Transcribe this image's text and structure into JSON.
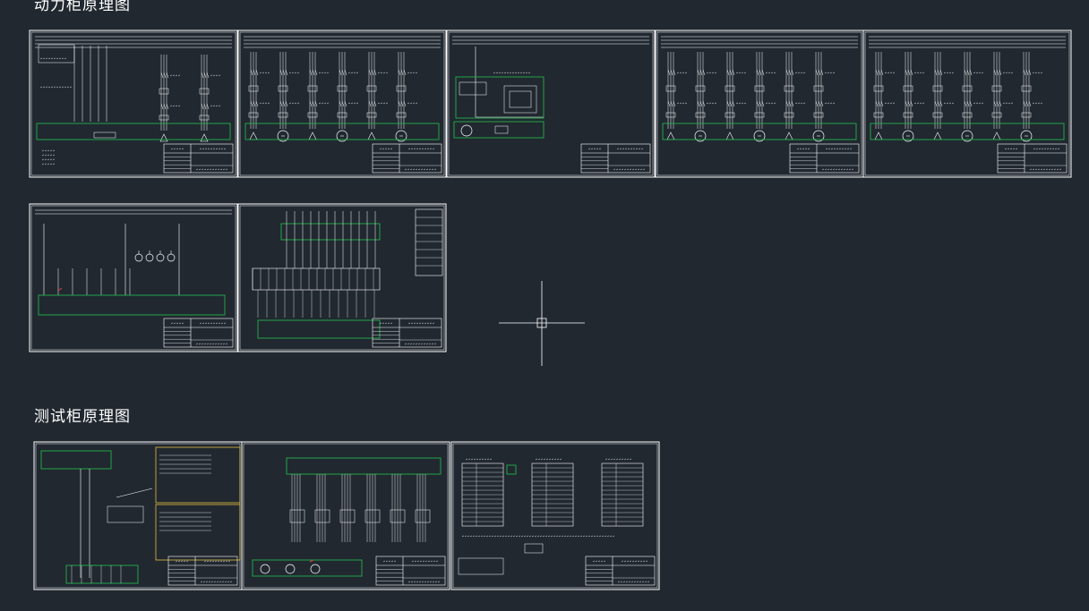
{
  "drawing": {
    "background_color": "#212830",
    "line_color": "#ffffff",
    "highlight_color": "#22b24c",
    "accent_color": "#e0c040",
    "headings": {
      "power_cabinet": "动力柜原理图",
      "test_cabinet": "测试柜原理图"
    },
    "sheets": [
      {
        "group": "power-cabinet",
        "index": 1,
        "content": "feeder-with-legend"
      },
      {
        "group": "power-cabinet",
        "index": 2,
        "content": "motor-starters"
      },
      {
        "group": "power-cabinet",
        "index": 3,
        "content": "control-circuit"
      },
      {
        "group": "power-cabinet",
        "index": 4,
        "content": "motor-starters"
      },
      {
        "group": "power-cabinet",
        "index": 5,
        "content": "motor-starters"
      },
      {
        "group": "power-cabinet",
        "index": 6,
        "content": "lighting-circuit"
      },
      {
        "group": "power-cabinet",
        "index": 7,
        "content": "terminal-wiring"
      },
      {
        "group": "test-cabinet",
        "index": 1,
        "content": "instrument-wiring"
      },
      {
        "group": "test-cabinet",
        "index": 2,
        "content": "test-outputs"
      },
      {
        "group": "test-cabinet",
        "index": 3,
        "content": "terminal-tables"
      }
    ],
    "crosshair_cursor": true
  }
}
